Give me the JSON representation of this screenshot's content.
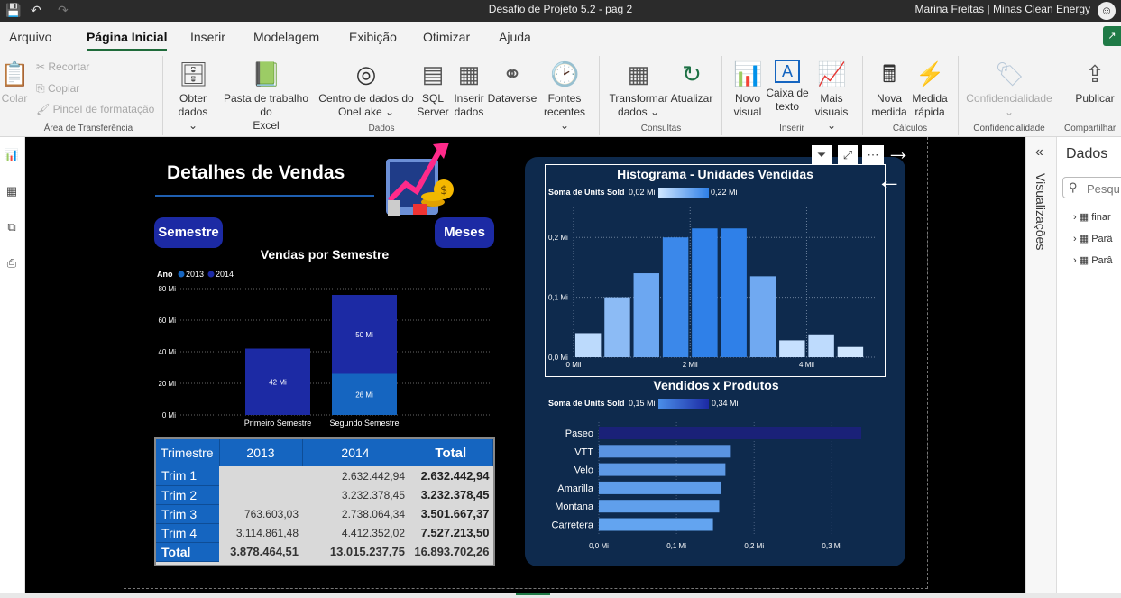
{
  "titlebar": {
    "title": "Desafio de Projeto 5.2 - pag 2",
    "user": "Marina Freitas | Minas Clean Energy"
  },
  "menu": [
    "Arquivo",
    "Página Inicial",
    "Inserir",
    "Modelagem",
    "Exibição",
    "Otimizar",
    "Ajuda"
  ],
  "ribbon": {
    "clipboard": {
      "colar": "Colar",
      "recortar": "Recortar",
      "copiar": "Copiar",
      "pincel": "Pincel de formatação",
      "group": "Área de Transferência"
    },
    "dados": {
      "obter1": "Obter",
      "obter2": "dados ⌄",
      "pasta1": "Pasta de trabalho do",
      "pasta2": "Excel",
      "centro1": "Centro de dados do",
      "centro2": "OneLake ⌄",
      "sql1": "SQL",
      "sql2": "Server",
      "inserir1": "Inserir",
      "inserir2": "dados",
      "dataverse": "Dataverse",
      "fontes1": "Fontes",
      "fontes2": "recentes ⌄",
      "group": "Dados"
    },
    "consultas": {
      "transf1": "Transformar",
      "transf2": "dados ⌄",
      "atualizar": "Atualizar",
      "group": "Consultas"
    },
    "inserir": {
      "novo1": "Novo",
      "novo2": "visual",
      "caixa1": "Caixa de",
      "caixa2": "texto",
      "mais1": "Mais",
      "mais2": "visuais ⌄",
      "group": "Inserir"
    },
    "calculos": {
      "nova1": "Nova",
      "nova2": "medida",
      "rapida1": "Medida",
      "rapida2": "rápida",
      "group": "Cálculos"
    },
    "conf": {
      "label": "Confidencialidade",
      "arrow": "⌄",
      "group": "Confidencialidade"
    },
    "compart": {
      "label": "Publicar",
      "group": "Compartilhar"
    }
  },
  "panes": {
    "vis": "Visualizações",
    "dados": "Dados",
    "search": "Pesqu",
    "items": [
      "finar",
      "Parâ",
      "Parâ"
    ]
  },
  "report": {
    "title": "Detalhes de Vendas",
    "pill_semestre": "Semestre",
    "pill_meses": "Meses",
    "semester_chart": {
      "title": "Vendas por Semestre",
      "legend_title": "Ano",
      "legend": [
        "2013",
        "2014"
      ],
      "y_ticks": [
        "80 Mi",
        "60 Mi",
        "40 Mi",
        "20 Mi",
        "0 Mi"
      ]
    },
    "hist": {
      "title": "Histograma - Unidades Vendidas",
      "legend_label": "Soma de Units Sold",
      "legend_min": "0,02 Mi",
      "legend_max": "0,22 Mi",
      "y_ticks": [
        "0,2 Mi",
        "0,1 Mi",
        "0,0 Mi"
      ],
      "x_ticks": [
        "0 Mil",
        "2 Mil",
        "4 Mil"
      ]
    },
    "prod": {
      "title": "Vendidos x Produtos",
      "legend_label": "Soma de Units Sold",
      "legend_min": "0,15 Mi",
      "legend_max": "0,34 Mi",
      "x_ticks": [
        "0,0 Mi",
        "0,1 Mi",
        "0,2 Mi",
        "0,3 Mi"
      ]
    }
  },
  "matrix": {
    "headers": [
      "Trimestre",
      "2013",
      "2014",
      "Total"
    ],
    "rows": [
      {
        "label": "Trim 1",
        "v2013": "",
        "v2014": "2.632.442,94",
        "total": "2.632.442,94"
      },
      {
        "label": "Trim 2",
        "v2013": "",
        "v2014": "3.232.378,45",
        "total": "3.232.378,45"
      },
      {
        "label": "Trim 3",
        "v2013": "763.603,03",
        "v2014": "2.738.064,34",
        "total": "3.501.667,37"
      },
      {
        "label": "Trim 4",
        "v2013": "3.114.861,48",
        "v2014": "4.412.352,02",
        "total": "7.527.213,50"
      },
      {
        "label": "Total",
        "v2013": "3.878.464,51",
        "v2014": "13.015.237,75",
        "total": "16.893.702,26"
      }
    ]
  },
  "chart_data": [
    {
      "type": "bar",
      "title": "Vendas por Semestre",
      "categories": [
        "Primeiro Semestre",
        "Segundo Semestre"
      ],
      "series": [
        {
          "name": "2013",
          "values": [
            0,
            26
          ],
          "labels": [
            "",
            "26 Mi"
          ],
          "color": "#1565c0"
        },
        {
          "name": "2014",
          "values": [
            42,
            50
          ],
          "labels": [
            "42 Mi",
            "50 Mi"
          ],
          "color": "#1c2aa4"
        }
      ],
      "stacked": true,
      "ylim": [
        0,
        80
      ],
      "ylabel": "",
      "xlabel": ""
    },
    {
      "type": "bar",
      "title": "Histograma - Unidades Vendidas",
      "x": [
        0.03,
        0.53,
        1.03,
        1.53,
        2.03,
        2.53,
        3.03,
        3.53,
        4.03,
        4.53
      ],
      "values": [
        0.04,
        0.1,
        0.14,
        0.2,
        0.215,
        0.215,
        0.135,
        0.028,
        0.038,
        0.017
      ],
      "xlim": [
        0,
        5.2
      ],
      "ylim": [
        0,
        0.25
      ]
    },
    {
      "type": "bar",
      "orientation": "horizontal",
      "title": "Vendidos x Produtos",
      "categories": [
        "Paseo",
        "VTT",
        "Velo",
        "Amarilla",
        "Montana",
        "Carretera"
      ],
      "values": [
        0.338,
        0.17,
        0.163,
        0.157,
        0.155,
        0.147
      ],
      "xlim": [
        0,
        0.36
      ]
    }
  ],
  "colors": {
    "canvas": "#000000",
    "panel": "#0e2a4d",
    "accent": "#1f7a46"
  }
}
